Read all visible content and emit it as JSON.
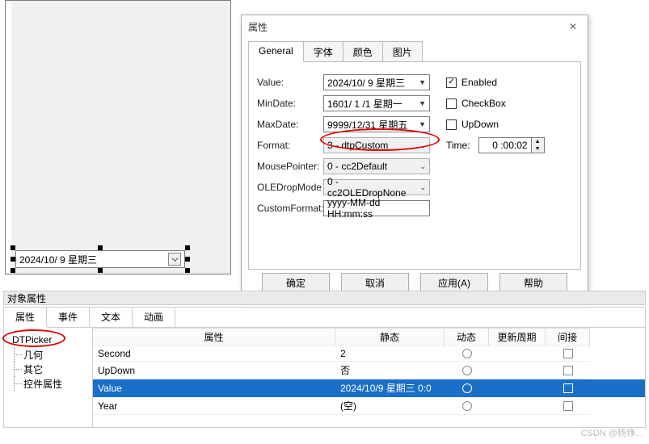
{
  "canvas": {
    "control_text": "2024/10/ 9  星期三"
  },
  "dialog": {
    "title": "属性",
    "tabs": [
      "General",
      "字体",
      "颜色",
      "图片"
    ],
    "active_tab": 0,
    "rows": {
      "value": {
        "label": "Value:",
        "text": "2024/10/ 9  星期三"
      },
      "min_date": {
        "label": "MinDate:",
        "text": "1601/ 1 /1  星期一"
      },
      "max_date": {
        "label": "MaxDate:",
        "text": "9999/12/31  星期五"
      },
      "format": {
        "label": "Format:",
        "text": "3 - dtpCustom"
      },
      "mouse_pointer": {
        "label": "MousePointer:",
        "text": "0 - cc2Default"
      },
      "ole_drop_mode": {
        "label": "OLEDropMode",
        "text": "0 - cc2OLEDropNone"
      },
      "custom_format": {
        "label": "CustomFormat:",
        "text": "yyyy-MM-dd HH:mm:ss"
      }
    },
    "checks": {
      "enabled": {
        "label": "Enabled",
        "checked": true
      },
      "checkbox": {
        "label": "CheckBox",
        "checked": false
      },
      "updown": {
        "label": "UpDown",
        "checked": false
      }
    },
    "time": {
      "label": "Time:",
      "value": "0 :00:02"
    },
    "buttons": {
      "ok": "确定",
      "cancel": "取消",
      "apply": "应用(A)",
      "help": "帮助"
    }
  },
  "object_panel": {
    "title": "对象属性",
    "tabs": [
      "属性",
      "事件",
      "文本",
      "动画"
    ],
    "active_tab": 0,
    "tree": {
      "root": "DTPicker",
      "children": [
        "几何",
        "其它",
        "控件属性"
      ]
    },
    "grid": {
      "headers": {
        "name": "属性",
        "stat": "静态",
        "dyn": "动态",
        "upd": "更新周期",
        "ind": "间接"
      },
      "rows": [
        {
          "name": "Second",
          "stat": "2"
        },
        {
          "name": "UpDown",
          "stat": "否"
        },
        {
          "name": "Value",
          "stat": "2024/10/9 星期三 0:0"
        },
        {
          "name": "Year",
          "stat": "(空)"
        }
      ],
      "selected": 2
    }
  },
  "watermark": "CSDN @杨铮..."
}
